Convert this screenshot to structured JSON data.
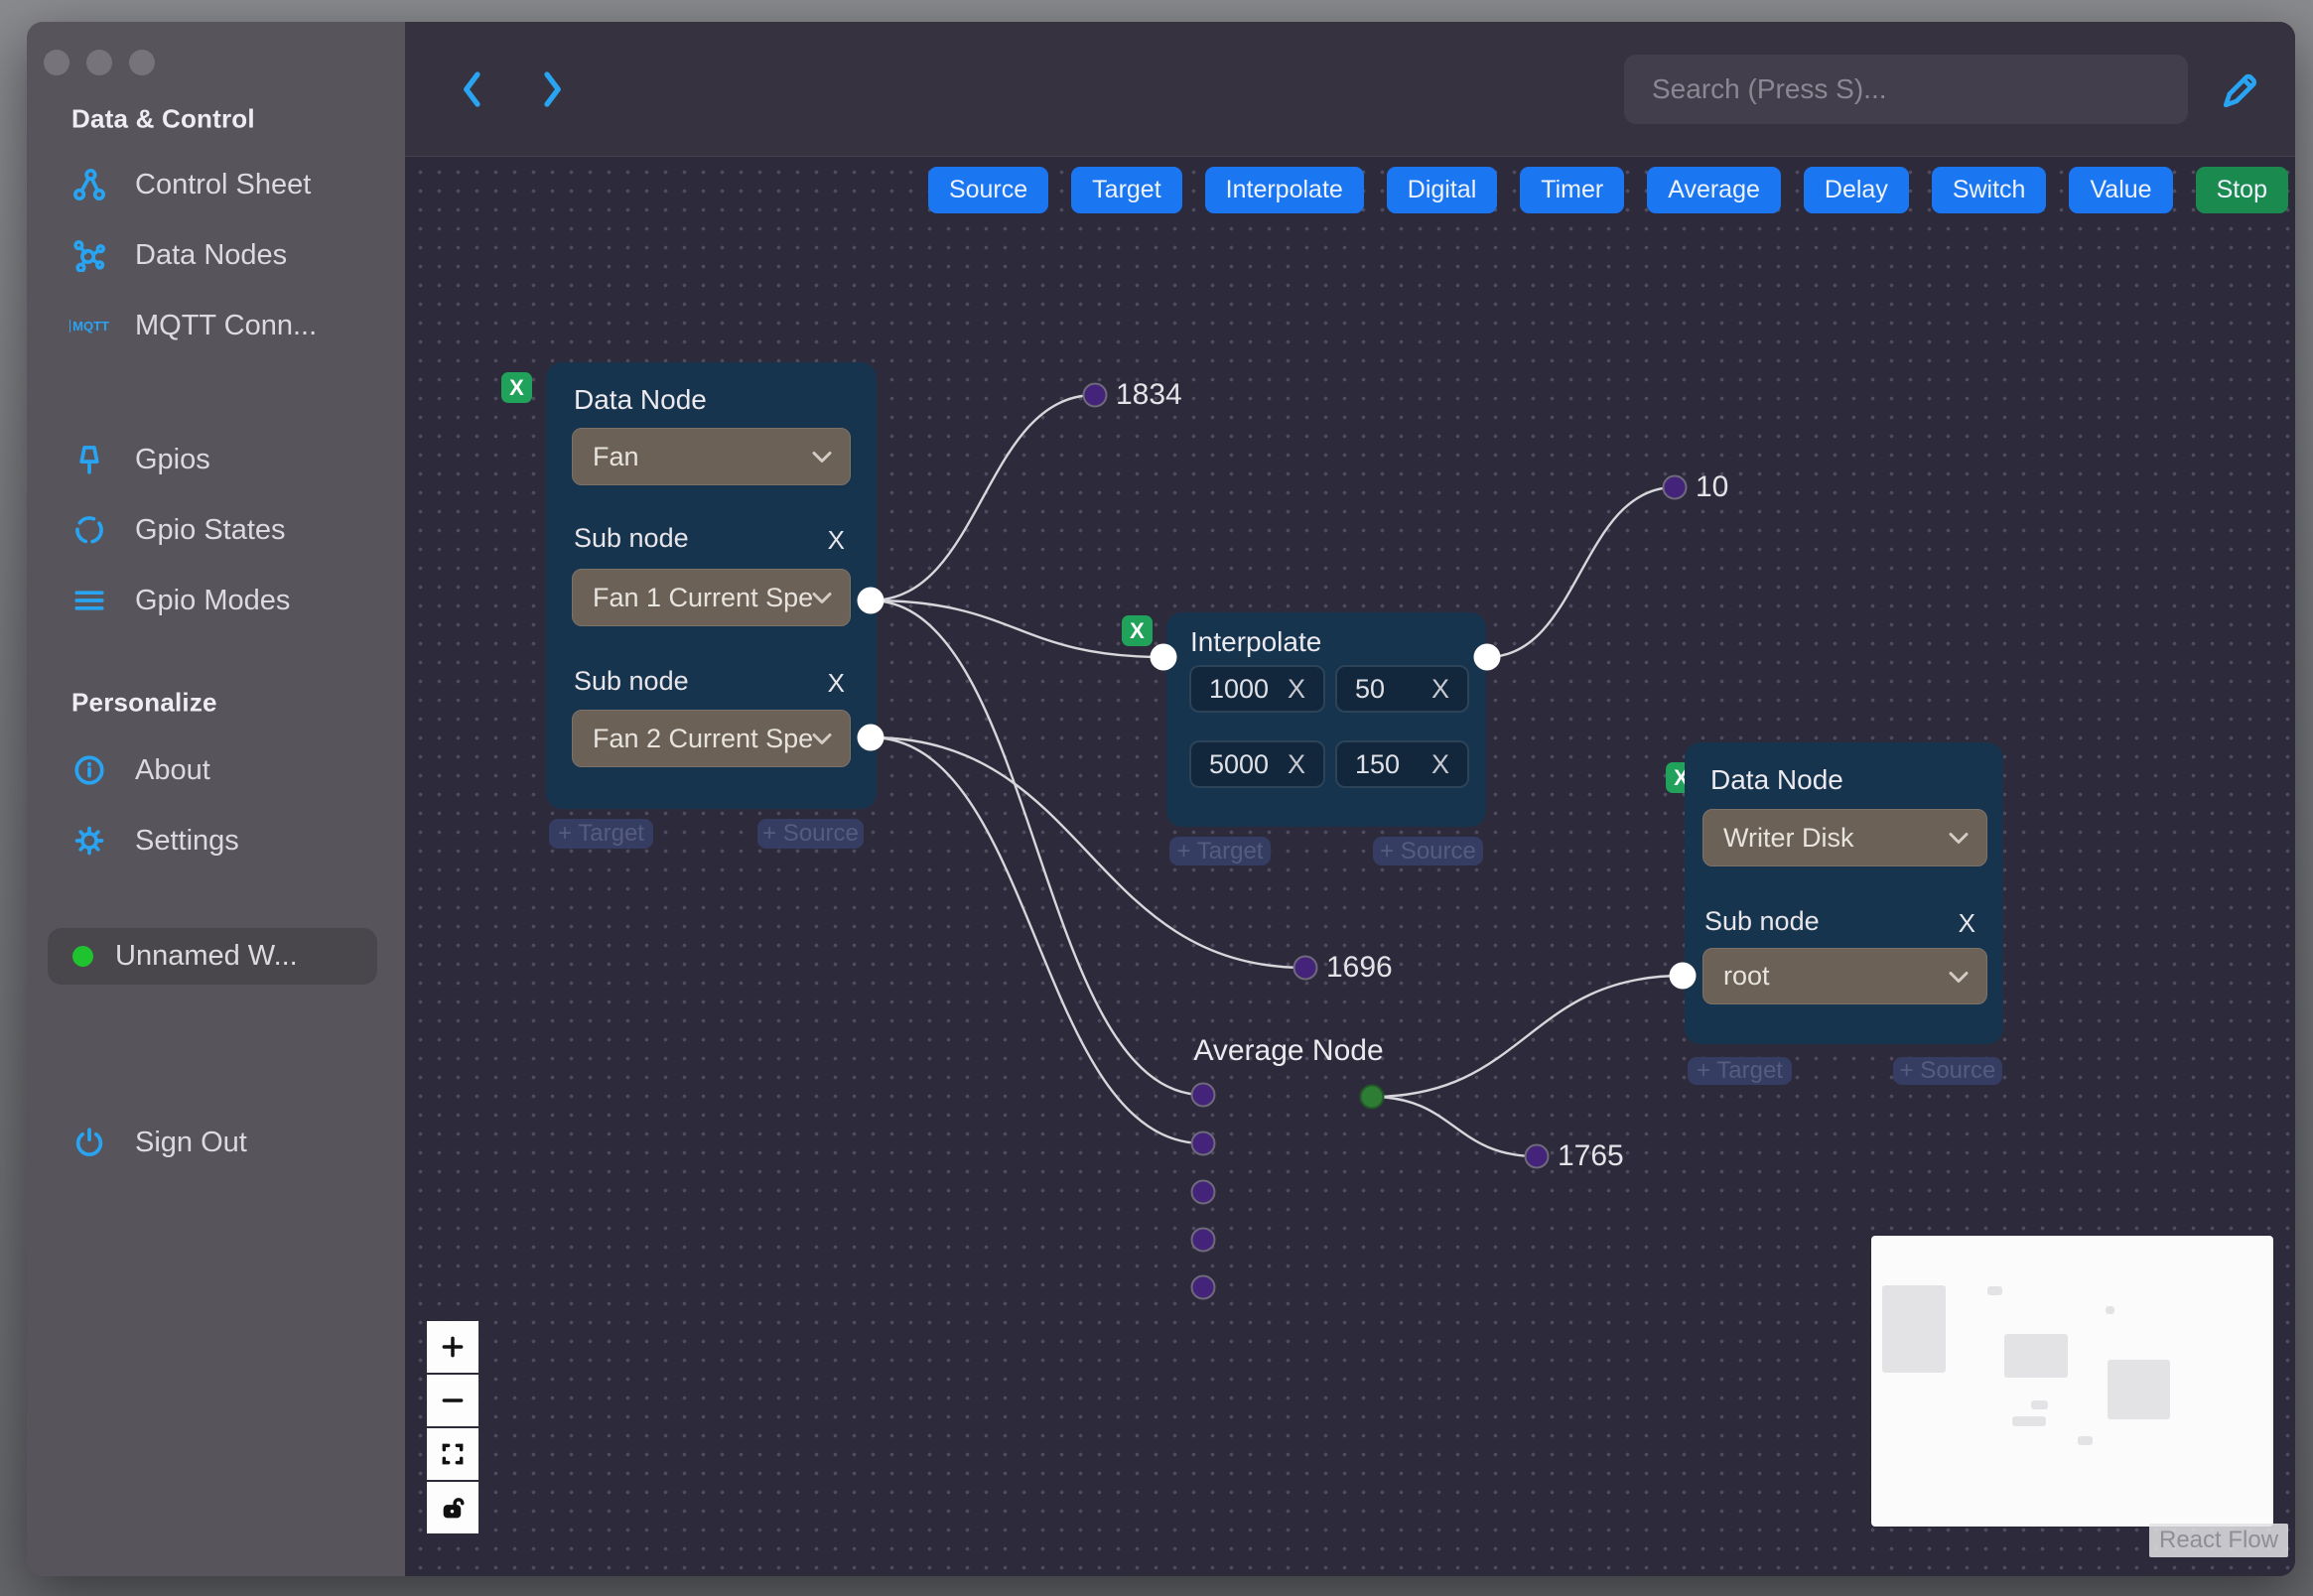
{
  "ui": {
    "x": "X"
  },
  "colors": {
    "icon_accent": "#29a4f2",
    "toolbar_blue": "#1b76f2",
    "stop_green": "#1a8a4e",
    "node_card": "#17344f",
    "handle_purple": "#44237a",
    "handle_green": "#2e7d35",
    "workspace_status": "#1fc32f"
  },
  "sidebar": {
    "header": "Data & Control",
    "items": [
      {
        "label": "Control Sheet"
      },
      {
        "label": "Data Nodes"
      },
      {
        "label": "MQTT Conn..."
      },
      {
        "label": "Gpios"
      },
      {
        "label": "Gpio States"
      },
      {
        "label": "Gpio Modes"
      }
    ],
    "personalize_header": "Personalize",
    "personalize_items": [
      {
        "label": "About"
      },
      {
        "label": "Settings"
      }
    ],
    "workspace": {
      "label": "Unnamed W..."
    },
    "sign_out_label": "Sign Out"
  },
  "topbar": {
    "search_placeholder": "Search (Press S)..."
  },
  "toolbar": {
    "buttons": [
      {
        "label": "Source",
        "variant": "blue"
      },
      {
        "label": "Target",
        "variant": "blue"
      },
      {
        "label": "Interpolate",
        "variant": "blue"
      },
      {
        "label": "Digital",
        "variant": "blue"
      },
      {
        "label": "Timer",
        "variant": "blue"
      },
      {
        "label": "Average",
        "variant": "blue"
      },
      {
        "label": "Delay",
        "variant": "blue"
      },
      {
        "label": "Switch",
        "variant": "blue"
      },
      {
        "label": "Value",
        "variant": "blue"
      },
      {
        "label": "Stop",
        "variant": "green"
      }
    ]
  },
  "canvas": {
    "nodes": {
      "fan": {
        "title": "Data Node",
        "type_value": "Fan",
        "sub1_label": "Sub node",
        "sub1_value": "Fan 1 Current Spe",
        "sub2_label": "Sub node",
        "sub2_value": "Fan 2 Current Spe"
      },
      "interpolate": {
        "title": "Interpolate",
        "inputs": [
          "1000",
          "50",
          "5000",
          "150"
        ]
      },
      "writer": {
        "title": "Data Node",
        "type_value": "Writer Disk",
        "sub_label": "Sub node",
        "sub_value": "root"
      },
      "average": {
        "title": "Average Node"
      }
    },
    "badges": {
      "target": "+ Target",
      "source": "+ Source"
    },
    "edge_labels": {
      "e1834": "1834",
      "e10": "10",
      "e1696": "1696",
      "e1765": "1765"
    },
    "attribution": "React Flow"
  }
}
